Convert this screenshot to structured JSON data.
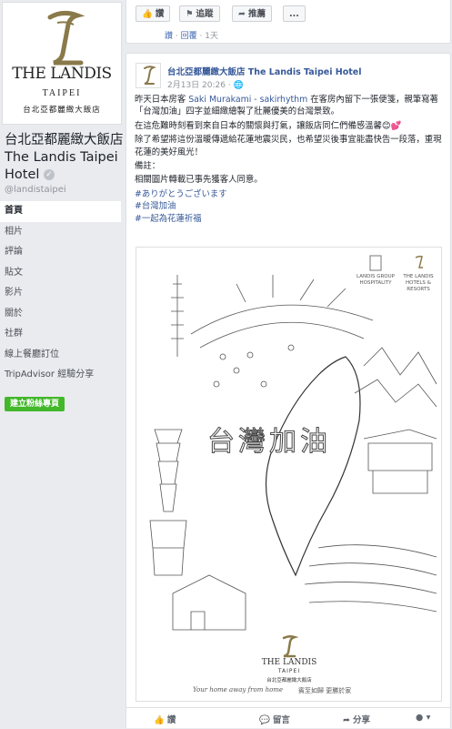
{
  "sidebar": {
    "logo": {
      "name": "THE LANDIS",
      "city": "TAIPEI",
      "cn": "台北亞都麗緻大飯店"
    },
    "page_name": "台北亞都麗緻大飯店 The Landis Taipei Hotel",
    "handle": "@landistaipei",
    "nav": [
      "首頁",
      "相片",
      "評論",
      "貼文",
      "影片",
      "關於",
      "社群",
      "線上餐廳訂位",
      "TripAdvisor 經驗分享"
    ],
    "create_button": "建立粉絲專頁"
  },
  "top_actions": {
    "like": "讚",
    "follow": "追蹤",
    "share": "推薦",
    "more": "...",
    "reply_line": {
      "like": "讚",
      "reply": "回覆",
      "time": "1天"
    }
  },
  "post": {
    "author": "台北亞都麗緻大飯店 The Landis Taipei Hotel",
    "time": "2月13日 20:26 ·",
    "p1_a": "昨天日本房客 ",
    "p1_link": "Saki Murakami - sakirhythm",
    "p1_b": " 在客房內留下一張便箋，親筆寫著「台灣加油」四字並細緻繪製了壯麗優美的台灣景致。",
    "p2": "在這危難時刻看到來自日本的關懷與打氣，讓飯店同仁們備感溫馨😊💕",
    "p3": "除了希望將這份溫暖傳遞給花蓮地震災民，也希望災後事宜能盡快告一段落，重現花蓮的美好風光！",
    "note_title": "備註：",
    "note_body": "相關圖片轉載已事先獲客人同意。",
    "tags": [
      "#ありがとうございます",
      "#台灣加油",
      "#一起為花蓮祈福"
    ],
    "image": {
      "slogan": "台灣加油",
      "footer_en": "Your home away from home",
      "footer_cn": "賓至如歸 更勝於家",
      "group_name": "LANDIS GROUP",
      "group_sub": "HOSPITALITY",
      "hotel_name": "THE LANDIS",
      "hotel_sub": "HOTELS & RESORTS",
      "logo_name": "THE LANDIS",
      "logo_city": "TAIPEI",
      "logo_cn": "台北亞都麗緻大飯店"
    },
    "footer": {
      "like": "讚",
      "comment": "留言",
      "share": "分享"
    }
  }
}
